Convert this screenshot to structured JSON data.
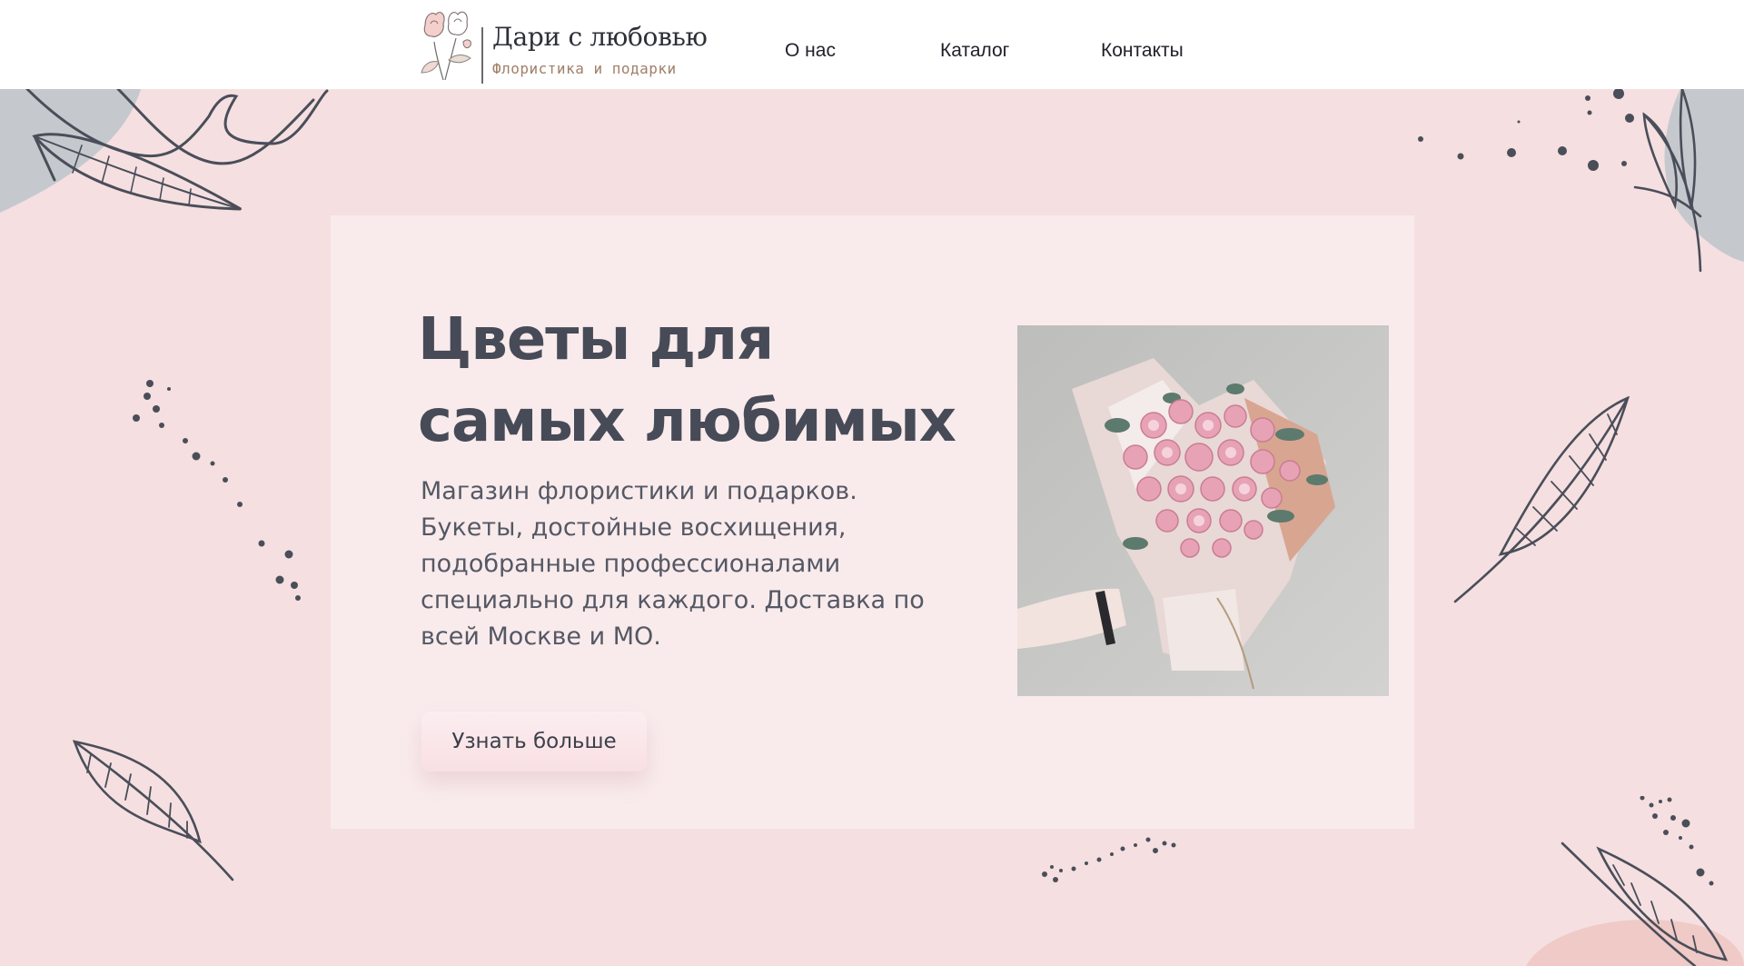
{
  "header": {
    "logo": {
      "title": "Дари с любовью",
      "subtitle": "Флористика и подарки"
    },
    "nav": [
      {
        "label": "О нас"
      },
      {
        "label": "Каталог"
      },
      {
        "label": "Контакты"
      }
    ]
  },
  "hero": {
    "title": "Цветы для самых любимых",
    "description": "Магазин флористики и подарков. Букеты, достойные восхищения, подобранные профессионалами специально для каждого. Доставка по всей Москве и МО.",
    "button_label": "Узнать больше"
  },
  "colors": {
    "background": "#f5dfe1",
    "card": "#f9ebec",
    "text": "#474b57",
    "accent_gray": "#c5c9ce",
    "logo_subtitle": "#a07f68"
  },
  "icons": {
    "logo_mark": "flower-sketch-icon",
    "decorations": [
      "leaf-sketch-icon",
      "dots-icon",
      "gray-blob"
    ]
  }
}
